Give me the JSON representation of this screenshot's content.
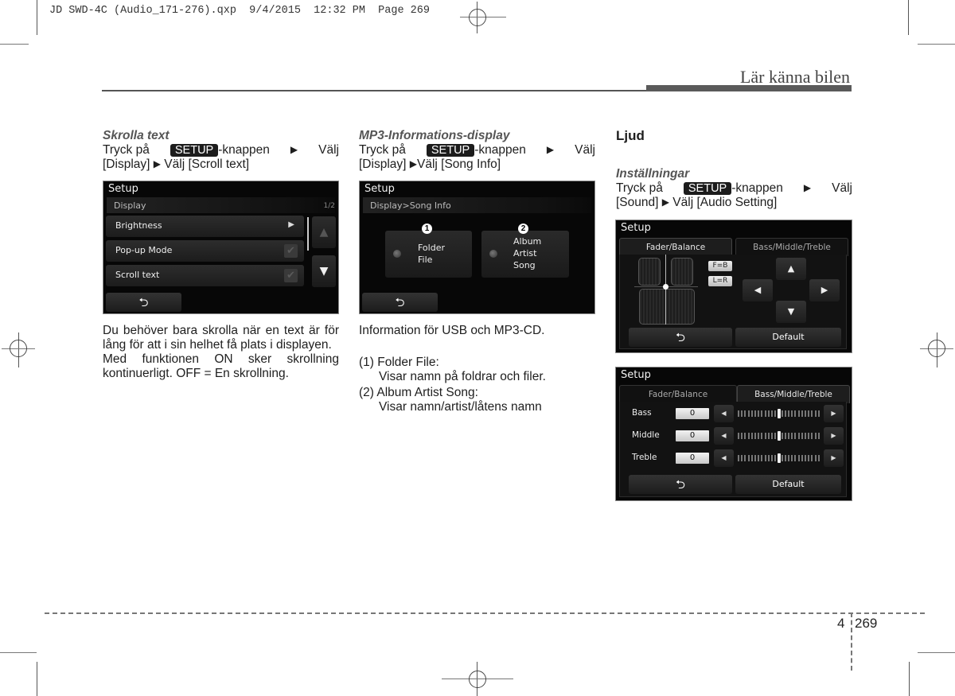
{
  "slug": "JD SWD-4C (Audio_171-276).qxp  9/4/2015  12:32 PM  Page 269",
  "header": {
    "section_title": "Lär känna bilen"
  },
  "columns": [
    {
      "subheading": "Skrolla text",
      "instruction": {
        "press": "Tryck på",
        "key": "SETUP",
        "suffix": "-knappen",
        "select": "Välj",
        "line2_a": "[Display]",
        "line2_b": "Välj [Scroll text]"
      },
      "screen": {
        "title": "Setup",
        "subtitle": "Display",
        "page_indicator": "1/2",
        "items": [
          {
            "label": "Brightness",
            "control": "arrow",
            "icon": "play-arrow-icon",
            "glyph": "▶"
          },
          {
            "label": "Pop-up Mode",
            "control": "checkbox",
            "checked": true,
            "glyph": "✔"
          },
          {
            "label": "Scroll text",
            "control": "checkbox",
            "checked": true,
            "glyph": "✔"
          }
        ],
        "up_glyph": "▲",
        "down_glyph": "▼",
        "back_glyph": "⮌"
      },
      "body": [
        "Du behöver bara skrolla när en text är för lång för att i sin helhet få plats i displayen.",
        "Med funktionen ON sker skrollning kontinuerligt. OFF = En skrollning."
      ]
    },
    {
      "subheading": "MP3-Informations-display",
      "instruction": {
        "press": "Tryck på",
        "key": "SETUP",
        "suffix": "-knappen",
        "select": "Välj",
        "line2_a": "[Display]",
        "line2_b": "Välj [Song Info]"
      },
      "screen": {
        "title": "Setup",
        "subtitle": "Display>Song Info",
        "options": [
          {
            "number": "1",
            "lines": [
              "Folder",
              "File"
            ],
            "selected": false
          },
          {
            "number": "2",
            "lines": [
              "Album",
              "Artist",
              "Song"
            ],
            "selected": false
          }
        ],
        "back_glyph": "⮌"
      },
      "intro": "Information för USB och MP3-CD.",
      "list": [
        {
          "label": "(1) Folder File:",
          "desc": "Visar namn på foldrar och filer."
        },
        {
          "label": "(2) Album Artist Song:",
          "desc": "Visar namn/artist/låtens namn"
        }
      ]
    },
    {
      "heading": "Ljud",
      "subheading": "Inställningar",
      "instruction": {
        "press": "Tryck på",
        "key": "SETUP",
        "suffix": "-knappen",
        "select": "Välj",
        "line2_a": "[Sound]",
        "line2_b": "Välj [Audio Setting]"
      },
      "screen_fader": {
        "title": "Setup",
        "tabs": [
          "Fader/Balance",
          "Bass/Middle/Treble"
        ],
        "active_tab": 0,
        "fb_label": "F=B",
        "lr_label": "L=R",
        "fader": 0,
        "balance": 0,
        "dpad": {
          "up": "▲",
          "down": "▼",
          "left": "◀",
          "right": "▶"
        },
        "back_glyph": "⮌",
        "default_label": "Default"
      },
      "screen_eq": {
        "title": "Setup",
        "tabs": [
          "Fader/Balance",
          "Bass/Middle/Treble"
        ],
        "active_tab": 1,
        "rows": [
          {
            "label": "Bass",
            "value": "0",
            "level": 0.5
          },
          {
            "label": "Middle",
            "value": "0",
            "level": 0.5
          },
          {
            "label": "Treble",
            "value": "0",
            "level": 0.5
          }
        ],
        "left_glyph": "◀",
        "right_glyph": "▶",
        "back_glyph": "⮌",
        "default_label": "Default"
      }
    }
  ],
  "footer": {
    "chapter": "4",
    "page": "269"
  }
}
